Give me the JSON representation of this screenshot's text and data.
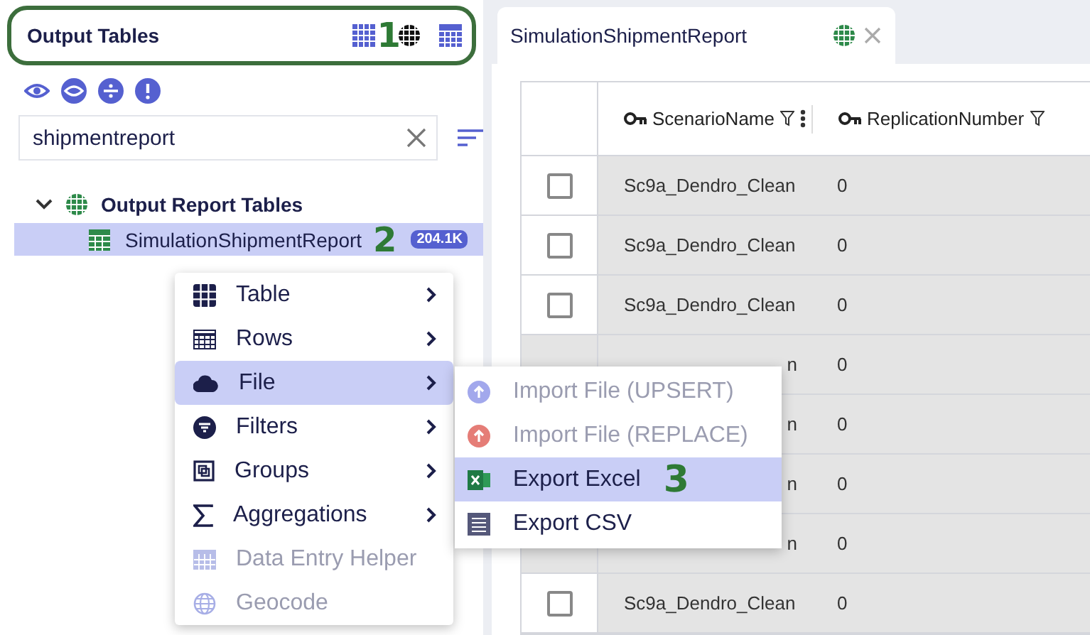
{
  "panel": {
    "title": "Output Tables",
    "search": {
      "value": "shipmentreport"
    },
    "tree": [
      {
        "label": "Output Report Tables",
        "expanded": true,
        "children": [
          {
            "label": "SimulationShipmentReport",
            "badge": "204.1K",
            "selected": true
          }
        ]
      }
    ]
  },
  "tab": {
    "title": "SimulationShipmentReport"
  },
  "table": {
    "columns": [
      {
        "label": "ScenarioName"
      },
      {
        "label": "ReplicationNumber"
      }
    ],
    "rows": [
      {
        "kind": "full",
        "checked": false,
        "cells": [
          "Sc9a_Dendro_Clean",
          "0"
        ]
      },
      {
        "kind": "full",
        "checked": false,
        "cells": [
          "Sc9a_Dendro_Clean",
          "0"
        ]
      },
      {
        "kind": "full",
        "checked": false,
        "cells": [
          "Sc9a_Dendro_Clean",
          "0"
        ]
      },
      {
        "kind": "covered",
        "cells": [
          "n",
          "0"
        ]
      },
      {
        "kind": "covered",
        "cells": [
          "n",
          "0"
        ]
      },
      {
        "kind": "covered",
        "cells": [
          "n",
          "0"
        ]
      },
      {
        "kind": "covered",
        "cells": [
          "n",
          "0"
        ]
      },
      {
        "kind": "full",
        "checked": false,
        "cells": [
          "Sc9a_Dendro_Clean",
          "0"
        ]
      }
    ]
  },
  "context_menu": [
    {
      "label": "Table",
      "kind": "grid",
      "submenu": true,
      "disabled": false,
      "selected": false
    },
    {
      "label": "Rows",
      "kind": "rows",
      "submenu": true,
      "disabled": false,
      "selected": false
    },
    {
      "label": "File",
      "kind": "cloud",
      "submenu": true,
      "disabled": false,
      "selected": true
    },
    {
      "label": "Filters",
      "kind": "filter",
      "submenu": true,
      "disabled": false,
      "selected": false
    },
    {
      "label": "Groups",
      "kind": "groups",
      "submenu": true,
      "disabled": false,
      "selected": false
    },
    {
      "label": "Aggregations",
      "kind": "sigma",
      "submenu": true,
      "disabled": false,
      "selected": false
    },
    {
      "label": "Data Entry Helper",
      "kind": "rows",
      "submenu": false,
      "disabled": true,
      "selected": false
    },
    {
      "label": "Geocode",
      "kind": "globe",
      "submenu": false,
      "disabled": true,
      "selected": false
    }
  ],
  "submenu": [
    {
      "label": "Import File (UPSERT)",
      "kind": "upload",
      "color": "#a2a8ec",
      "disabled": true,
      "selected": false
    },
    {
      "label": "Import File (REPLACE)",
      "kind": "upload",
      "color": "#e57d77",
      "disabled": true,
      "selected": false
    },
    {
      "label": "Export Excel",
      "kind": "excel",
      "disabled": false,
      "selected": true
    },
    {
      "label": "Export CSV",
      "kind": "lines",
      "disabled": false,
      "selected": false
    }
  ],
  "annotations": [
    "1",
    "2",
    "3"
  ]
}
